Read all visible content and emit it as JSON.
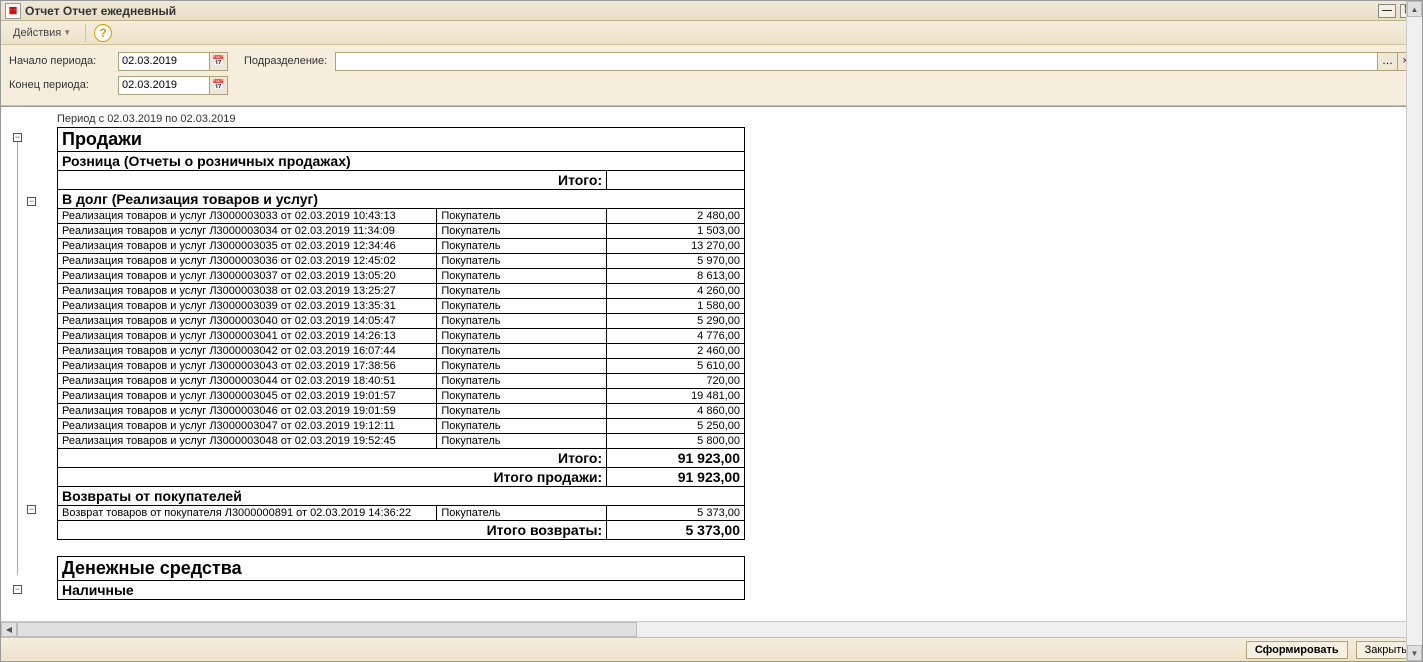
{
  "window": {
    "title": "Отчет  Отчет ежедневный"
  },
  "toolbar": {
    "actions_label": "Действия"
  },
  "params": {
    "start_label": "Начало периода:",
    "end_label": "Конец периода:",
    "division_label": "Подразделение:",
    "start_value": "02.03.2019",
    "end_value": "02.03.2019",
    "division_value": ""
  },
  "report": {
    "period_text": "Период с 02.03.2019 по 02.03.2019",
    "h_sales": "Продажи",
    "h_retail": "Розница (Отчеты о розничных продажах)",
    "itogo_label": "Итого:",
    "h_credit": "В долг (Реализация товаров и услуг)",
    "credit_rows": [
      {
        "desc": "Реализация товаров и услуг Л3000003033 от 02.03.2019 10:43:13",
        "buyer": "Покупатель",
        "amt": "2 480,00"
      },
      {
        "desc": "Реализация товаров и услуг Л3000003034 от 02.03.2019 11:34:09",
        "buyer": "Покупатель",
        "amt": "1 503,00"
      },
      {
        "desc": "Реализация товаров и услуг Л3000003035 от 02.03.2019 12:34:46",
        "buyer": "Покупатель",
        "amt": "13 270,00"
      },
      {
        "desc": "Реализация товаров и услуг Л3000003036 от 02.03.2019 12:45:02",
        "buyer": "Покупатель",
        "amt": "5 970,00"
      },
      {
        "desc": "Реализация товаров и услуг Л3000003037 от 02.03.2019 13:05:20",
        "buyer": "Покупатель",
        "amt": "8 613,00"
      },
      {
        "desc": "Реализация товаров и услуг Л3000003038 от 02.03.2019 13:25:27",
        "buyer": "Покупатель",
        "amt": "4 260,00"
      },
      {
        "desc": "Реализация товаров и услуг Л3000003039 от 02.03.2019 13:35:31",
        "buyer": "Покупатель",
        "amt": "1 580,00"
      },
      {
        "desc": "Реализация товаров и услуг Л3000003040 от 02.03.2019 14:05:47",
        "buyer": "Покупатель",
        "amt": "5 290,00"
      },
      {
        "desc": "Реализация товаров и услуг Л3000003041 от 02.03.2019 14:26:13",
        "buyer": "Покупатель",
        "amt": "4 776,00"
      },
      {
        "desc": "Реализация товаров и услуг Л3000003042 от 02.03.2019 16:07:44",
        "buyer": "Покупатель",
        "amt": "2 460,00"
      },
      {
        "desc": "Реализация товаров и услуг Л3000003043 от 02.03.2019 17:38:56",
        "buyer": "Покупатель",
        "amt": "5 610,00"
      },
      {
        "desc": "Реализация товаров и услуг Л3000003044 от 02.03.2019 18:40:51",
        "buyer": "Покупатель",
        "amt": "720,00"
      },
      {
        "desc": "Реализация товаров и услуг Л3000003045 от 02.03.2019 19:01:57",
        "buyer": "Покупатель",
        "amt": "19 481,00"
      },
      {
        "desc": "Реализация товаров и услуг Л3000003046 от 02.03.2019 19:01:59",
        "buyer": "Покупатель",
        "amt": "4 860,00"
      },
      {
        "desc": "Реализация товаров и услуг Л3000003047 от 02.03.2019 19:12:11",
        "buyer": "Покупатель",
        "amt": "5 250,00"
      },
      {
        "desc": "Реализация товаров и услуг Л3000003048 от 02.03.2019 19:52:45",
        "buyer": "Покупатель",
        "amt": "5 800,00"
      }
    ],
    "credit_total": "91 923,00",
    "sales_total_label": "Итого продажи:",
    "sales_total": "91 923,00",
    "h_returns": "Возвраты от покупателей",
    "return_rows": [
      {
        "desc": "Возврат товаров от покупателя Л3000000891 от 02.03.2019 14:36:22",
        "buyer": "Покупатель",
        "amt": "5 373,00"
      }
    ],
    "returns_total_label": "Итого возвраты:",
    "returns_total": "5 373,00",
    "h_cash": "Денежные средства",
    "h_cash_sub": "Наличные"
  },
  "footer": {
    "generate": "Сформировать",
    "close": "Закрыть"
  }
}
